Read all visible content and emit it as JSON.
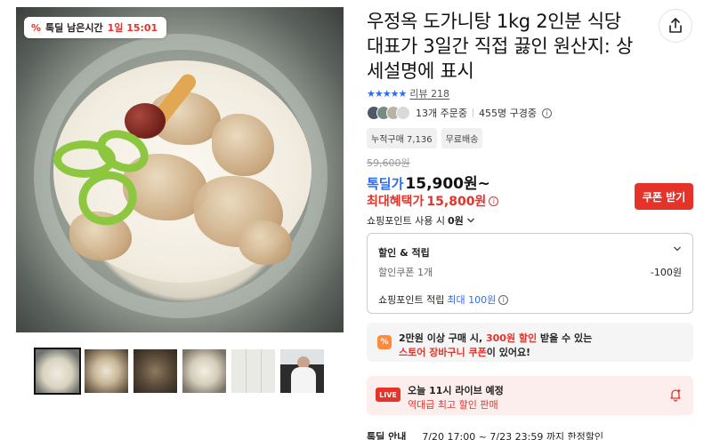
{
  "gallery": {
    "timer": {
      "label": "톡딜 남은시간",
      "highlight": "1일 15:01"
    },
    "thumbnails": [
      "thumb-1",
      "thumb-2",
      "thumb-3",
      "thumb-4",
      "thumb-5",
      "thumb-6"
    ]
  },
  "product": {
    "title": "우정옥 도가니탕 1kg 2인분 식당 대표가 3일간 직접 끓인 원산지: 상세설명에 표시",
    "rating_stars": "★★★★★",
    "review_label": "리뷰",
    "review_count": "218",
    "orders": "13개 주문중",
    "subscribers": "455명 구경중",
    "tags": [
      "누적구매 7,136",
      "무료배송"
    ]
  },
  "price": {
    "original": "59,600원",
    "sale_label": "톡딜가",
    "sale_price": "15,900원~",
    "benefit_label": "최대혜택가",
    "benefit_price": "15,800원",
    "coupon_button": "쿠폰 받기",
    "points_use": "쇼핑포인트 사용 시",
    "points_use_value": "0원"
  },
  "discount": {
    "title": "할인 & 적립",
    "coupon_label": "할인쿠폰 1개",
    "coupon_amount": "-100원",
    "points_label": "쇼핑포인트 적립",
    "points_max": "최대 100원"
  },
  "cart_promo": {
    "line1_a": "2만원 이상 구매 시, ",
    "line1_hl": "300원 할인",
    "line1_b": " 받을 수 있는",
    "line2_hl": "스토어 장바구니 쿠폰",
    "line2_b": "이 있어요!"
  },
  "live": {
    "badge": "LIVE",
    "line1": "오늘 11시 라이브 예정",
    "line2": "역대급 최고 할인 판매"
  },
  "notice": {
    "label": "톡딜 안내",
    "period": "7/20 17:00 ~ 7/23 23:59 까지 한정할인"
  },
  "colors": {
    "accent_red": "#e5332a",
    "accent_blue": "#2b6cf0"
  }
}
